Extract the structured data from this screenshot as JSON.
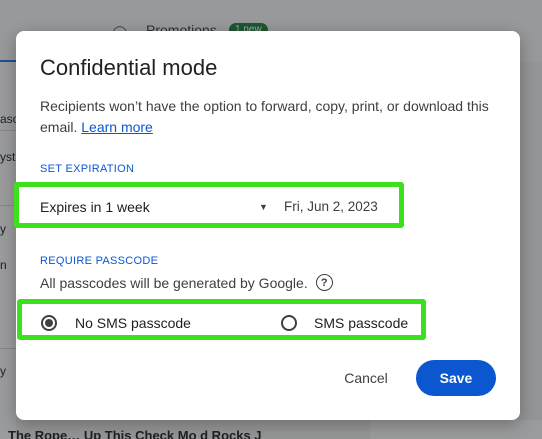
{
  "background": {
    "tab_label": "Promotions",
    "tab_badge": "1 new",
    "left_snippets": [
      "aso",
      "yst",
      "y",
      "n",
      "y"
    ],
    "bottom_text": "The Rope… Up  This Check Mo d  Rocks  J"
  },
  "dialog": {
    "title": "Confidential mode",
    "description": "Recipients won’t have the option to forward, copy, print, or download this email.",
    "learn_more": "Learn more",
    "expiration": {
      "section_label": "SET EXPIRATION",
      "selected_option": "Expires in 1 week",
      "date": "Fri, Jun 2, 2023"
    },
    "passcode": {
      "section_label": "REQUIRE PASSCODE",
      "info": "All passcodes will be generated by Google.",
      "help_icon": "?",
      "options": [
        {
          "label": "No SMS passcode",
          "selected": true
        },
        {
          "label": "SMS passcode",
          "selected": false
        }
      ]
    },
    "actions": {
      "cancel": "Cancel",
      "save": "Save"
    }
  },
  "colors": {
    "accent": "#0b57d0",
    "highlight": "#3ce01d"
  }
}
